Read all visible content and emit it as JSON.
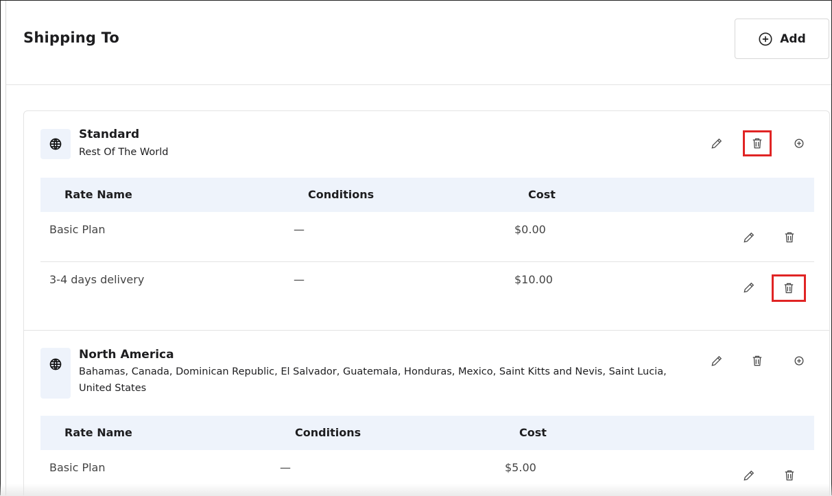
{
  "header": {
    "title": "Shipping To",
    "add_label": "Add"
  },
  "zones": [
    {
      "name": "Standard",
      "description": "Rest Of The World",
      "columns": [
        "Rate Name",
        "Conditions",
        "Cost"
      ],
      "rates": [
        {
          "name": "Basic Plan",
          "conditions": "—",
          "cost": "$0.00"
        },
        {
          "name": "3-4 days delivery",
          "conditions": "—",
          "cost": "$10.00"
        }
      ]
    },
    {
      "name": "North America",
      "description": "Bahamas, Canada, Dominican Republic, El Salvador, Guatemala, Honduras, Mexico, Saint Kitts and Nevis, Saint Lucia, United States",
      "columns": [
        "Rate Name",
        "Conditions",
        "Cost"
      ],
      "rates": [
        {
          "name": "Basic Plan",
          "conditions": "—",
          "cost": "$5.00"
        }
      ]
    }
  ],
  "colors": {
    "highlight": "#e02424",
    "table_header_bg": "#eef3fb",
    "border": "#e3e3e3"
  },
  "icons": {
    "zone": "globe-icon",
    "edit": "pencil-icon",
    "delete": "trash-icon",
    "add": "plus-circle-icon"
  }
}
